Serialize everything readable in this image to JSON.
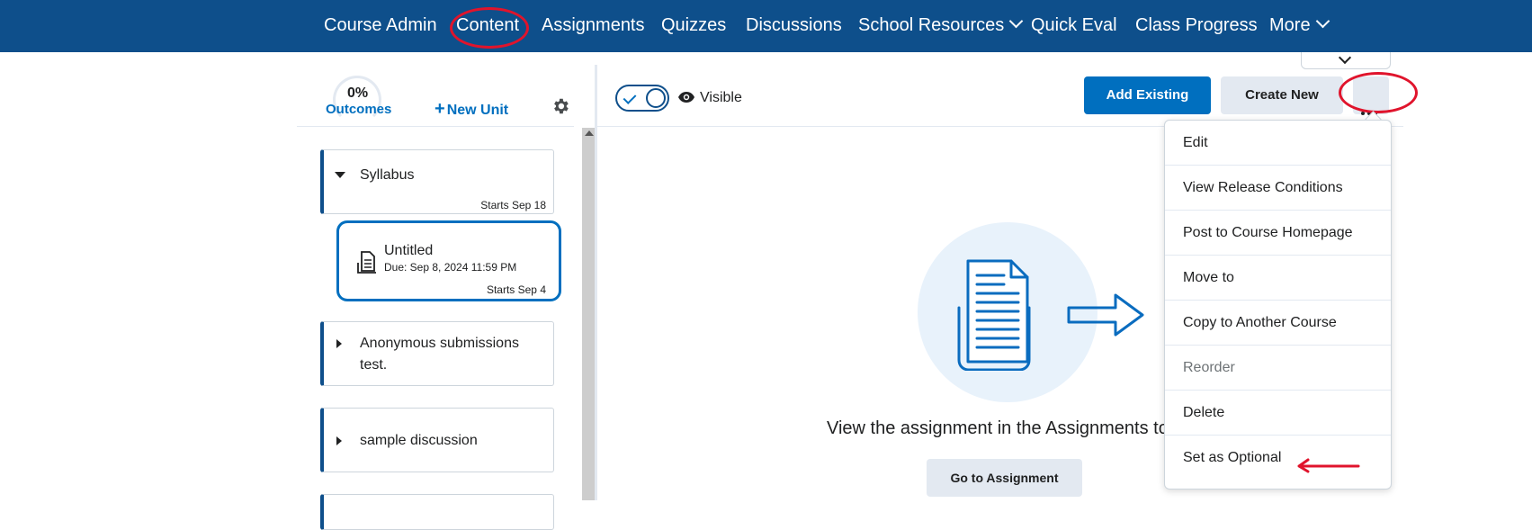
{
  "nav": {
    "items": [
      {
        "label": "Course Admin"
      },
      {
        "label": "Content"
      },
      {
        "label": "Assignments"
      },
      {
        "label": "Quizzes"
      },
      {
        "label": "Discussions"
      },
      {
        "label": "School Resources"
      },
      {
        "label": "Quick Eval"
      },
      {
        "label": "Class Progress"
      },
      {
        "label": "More"
      }
    ]
  },
  "sidebar": {
    "outcomes_percent": "0%",
    "outcomes_label": "Outcomes",
    "new_unit_label": "New Unit",
    "units": [
      {
        "title": "Syllabus",
        "starts": "Starts Sep 18",
        "expanded": true
      },
      {
        "title": "Anonymous submissions test.",
        "expanded": false
      },
      {
        "title": "sample discussion",
        "expanded": false
      }
    ],
    "selected_topic": {
      "title": "Untitled",
      "due": "Due: Sep 8, 2024 11:59 PM",
      "starts": "Starts Sep 4"
    }
  },
  "toolbar": {
    "visibility_label": "Visible",
    "visible": true,
    "add_existing_label": "Add Existing",
    "create_new_label": "Create New"
  },
  "main": {
    "empty_message": "View the assignment in the Assignments to",
    "go_to_button_label": "Go to Assignment"
  },
  "context_menu": {
    "items": [
      {
        "label": "Edit",
        "disabled": false
      },
      {
        "label": "View Release Conditions",
        "disabled": false
      },
      {
        "label": "Post to Course Homepage",
        "disabled": false
      },
      {
        "label": "Move to",
        "disabled": false
      },
      {
        "label": "Copy to Another Course",
        "disabled": false
      },
      {
        "label": "Reorder",
        "disabled": true
      },
      {
        "label": "Delete",
        "disabled": false
      },
      {
        "label": "Set as Optional",
        "disabled": false
      }
    ]
  },
  "colors": {
    "nav_bg": "#0e4f8b",
    "primary": "#006fbf",
    "annotation_red": "#e0142c",
    "secondary_bg": "#e3e9f1"
  },
  "icons": [
    "chevron-down-icon",
    "gear-icon",
    "plus-icon",
    "caret-down-icon",
    "caret-right-icon",
    "assignment-icon",
    "eye-icon",
    "check-icon",
    "more-dots-icon"
  ]
}
